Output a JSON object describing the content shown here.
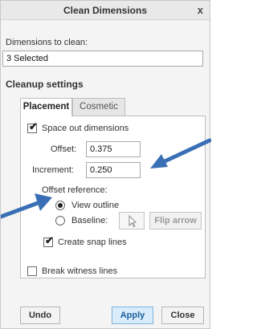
{
  "dialog": {
    "title": "Clean Dimensions",
    "close_glyph": "x"
  },
  "dimensions": {
    "label": "Dimensions to clean:",
    "value": "3 Selected"
  },
  "cleanup": {
    "title": "Cleanup settings",
    "tabs": [
      {
        "label": "Placement",
        "active": true
      },
      {
        "label": "Cosmetic",
        "active": false
      }
    ]
  },
  "placement": {
    "space_out": {
      "label": "Space out dimensions",
      "checked": true
    },
    "offset": {
      "label": "Offset:",
      "value": "0.375"
    },
    "increment": {
      "label": "Increment:",
      "value": "0.250"
    },
    "offset_reference": {
      "label": "Offset reference:",
      "view_outline": {
        "label": "View outline",
        "selected": true
      },
      "baseline": {
        "label": "Baseline:",
        "selected": false
      },
      "pick_icon": "cursor-arrow-icon",
      "flip_arrow_label": "Flip arrow"
    },
    "snap_lines": {
      "label": "Create snap lines",
      "checked": true
    }
  },
  "break_witness": {
    "label": "Break witness lines",
    "checked": false
  },
  "buttons": {
    "undo": "Undo",
    "apply": "Apply",
    "close": "Close"
  },
  "annotation_color": "#3a6fb5",
  "accent_color": "#d9ecfb"
}
